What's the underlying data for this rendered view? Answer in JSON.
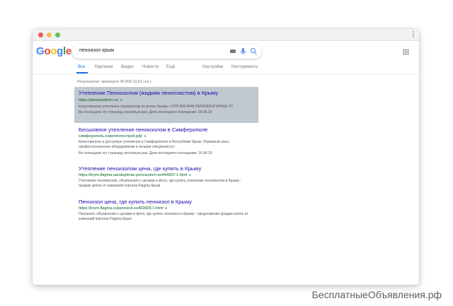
{
  "search": {
    "query": "пеноизол крым",
    "logo_letters": [
      "G",
      "o",
      "o",
      "g",
      "l",
      "e"
    ],
    "logo_colors": [
      "#4285f4",
      "#ea4335",
      "#fbbc05",
      "#4285f4",
      "#34a853",
      "#ea4335"
    ]
  },
  "tabs": [
    {
      "label": "Все",
      "active": true
    },
    {
      "label": "Картинки"
    },
    {
      "label": "Видео"
    },
    {
      "label": "Новости"
    },
    {
      "label": "Ещё"
    },
    {
      "label": "Настройки"
    },
    {
      "label": "Инструменты"
    }
  ],
  "stats": "Результатов: примерно 46 800 (0,63 сек.)",
  "results": [
    {
      "title": "Утепление Пеноизолом (жидким пенопластом) в Крыму",
      "url": "https://penoizolkrim.ru/",
      "snippet": "Качественное утепление пеноизолом по всему Крыму +7978 849 8449 ПЕНОИЗОЛ КРЫМ. РУ",
      "visited": "Вы посещали эту страницу несколько раз. Дата последнего посещения: 18.05.19",
      "highlighted": true
    },
    {
      "title": "Бесшовное утепление пеноизолом в Симферополе",
      "url": "симферополь.новотеплострой.рф/",
      "snippet": "Качественное и доступное утепление в Симферополе и Республике Крым. Огромный опыт, профессиональное оборудование и лучшие специалисты!",
      "visited": "Вы посещали эту страницу несколько раз. Дата последнего посещения: 16.04.19",
      "highlighted": false
    },
    {
      "title": "Утепление пеноизолом цена, где купить в Крыму",
      "url": "https://krym.flagma.ua/uteplenie-penoizolom-so444837-1.html",
      "snippet": "Утепление пеноизолом, объявления с ценами и фото, где купить утепление пеноизолом в Крыму - продаж куплю от компаний портала Flagma Крым",
      "highlighted": false
    },
    {
      "title": "Пеноизол цена, где купить пеноизол в Крыму",
      "url": "https://krym.flagma.ru/penoizol-so402826-1.html",
      "snippet": "Пеноизол, объявления с ценами и фото, где купить пеноизол в Крыму - предложения продаж куплю от компаний портала Flagma Крым",
      "highlighted": false
    }
  ],
  "watermark": "БесплатныеОбъявления.рф"
}
